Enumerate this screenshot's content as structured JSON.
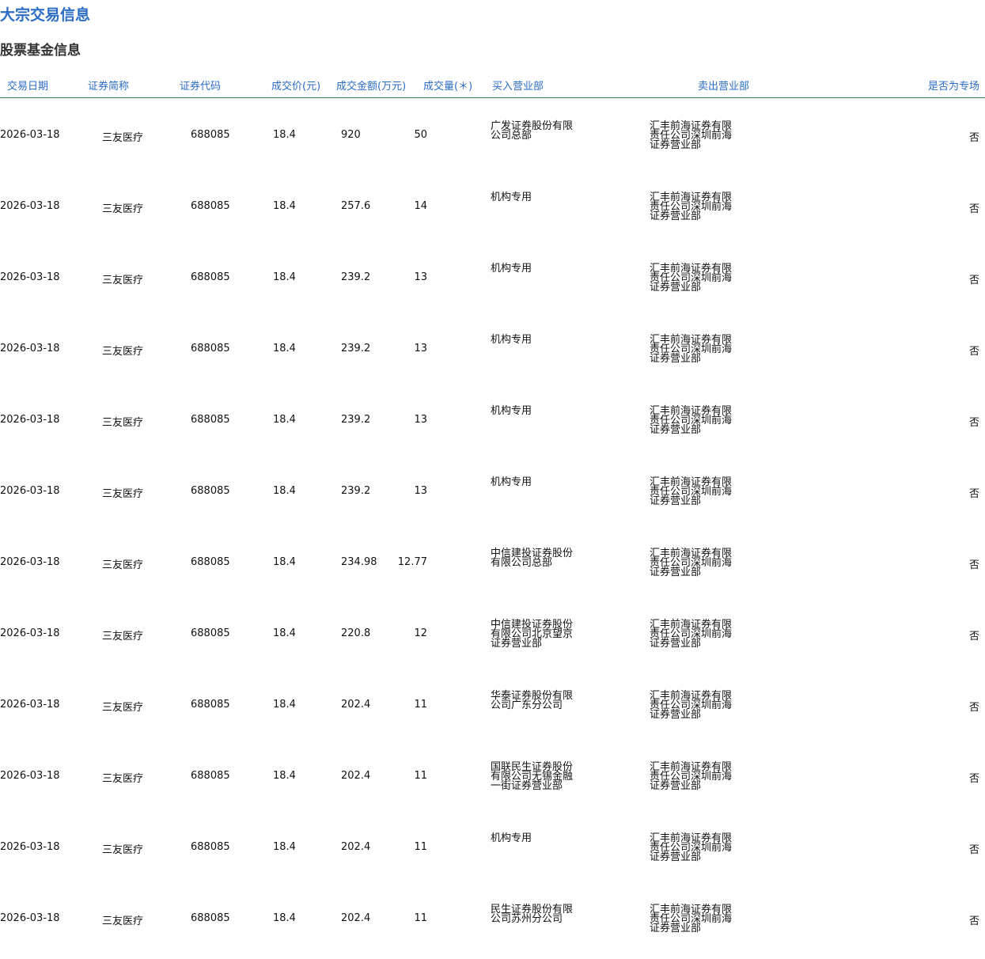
{
  "page": {
    "title": "大宗交易信息",
    "section_title": "股票基金信息"
  },
  "table": {
    "headers": {
      "date": "交易日期",
      "name": "证券简称",
      "code": "证券代码",
      "price": "成交价(元)",
      "amount": "成交金额(万元)",
      "volume": "成交量(＊)",
      "buyer": "买入营业部",
      "seller": "卖出营业部",
      "special": "是否为专场"
    },
    "rows": [
      {
        "date": "2026-03-18",
        "name": "三友医疗",
        "code": "688085",
        "price": "18.4",
        "amount": "920",
        "volume": "50",
        "buyer": "广发证券股份有限公司总部",
        "seller": "汇丰前海证券有限责任公司深圳前海证券营业部",
        "special": "否"
      },
      {
        "date": "2026-03-18",
        "name": "三友医疗",
        "code": "688085",
        "price": "18.4",
        "amount": "257.6",
        "volume": "14",
        "buyer": "机构专用",
        "seller": "汇丰前海证券有限责任公司深圳前海证券营业部",
        "special": "否"
      },
      {
        "date": "2026-03-18",
        "name": "三友医疗",
        "code": "688085",
        "price": "18.4",
        "amount": "239.2",
        "volume": "13",
        "buyer": "机构专用",
        "seller": "汇丰前海证券有限责任公司深圳前海证券营业部",
        "special": "否"
      },
      {
        "date": "2026-03-18",
        "name": "三友医疗",
        "code": "688085",
        "price": "18.4",
        "amount": "239.2",
        "volume": "13",
        "buyer": "机构专用",
        "seller": "汇丰前海证券有限责任公司深圳前海证券营业部",
        "special": "否"
      },
      {
        "date": "2026-03-18",
        "name": "三友医疗",
        "code": "688085",
        "price": "18.4",
        "amount": "239.2",
        "volume": "13",
        "buyer": "机构专用",
        "seller": "汇丰前海证券有限责任公司深圳前海证券营业部",
        "special": "否"
      },
      {
        "date": "2026-03-18",
        "name": "三友医疗",
        "code": "688085",
        "price": "18.4",
        "amount": "239.2",
        "volume": "13",
        "buyer": "机构专用",
        "seller": "汇丰前海证券有限责任公司深圳前海证券营业部",
        "special": "否"
      },
      {
        "date": "2026-03-18",
        "name": "三友医疗",
        "code": "688085",
        "price": "18.4",
        "amount": "234.98",
        "volume": "12.77",
        "buyer": "中信建投证券股份有限公司总部",
        "seller": "汇丰前海证券有限责任公司深圳前海证券营业部",
        "special": "否"
      },
      {
        "date": "2026-03-18",
        "name": "三友医疗",
        "code": "688085",
        "price": "18.4",
        "amount": "220.8",
        "volume": "12",
        "buyer": "中信建投证券股份有限公司北京望京证券营业部",
        "seller": "汇丰前海证券有限责任公司深圳前海证券营业部",
        "special": "否"
      },
      {
        "date": "2026-03-18",
        "name": "三友医疗",
        "code": "688085",
        "price": "18.4",
        "amount": "202.4",
        "volume": "11",
        "buyer": "华泰证券股份有限公司广东分公司",
        "seller": "汇丰前海证券有限责任公司深圳前海证券营业部",
        "special": "否"
      },
      {
        "date": "2026-03-18",
        "name": "三友医疗",
        "code": "688085",
        "price": "18.4",
        "amount": "202.4",
        "volume": "11",
        "buyer": "国联民生证券股份有限公司无锡金融一街证券营业部",
        "seller": "汇丰前海证券有限责任公司深圳前海证券营业部",
        "special": "否"
      },
      {
        "date": "2026-03-18",
        "name": "三友医疗",
        "code": "688085",
        "price": "18.4",
        "amount": "202.4",
        "volume": "11",
        "buyer": "机构专用",
        "seller": "汇丰前海证券有限责任公司深圳前海证券营业部",
        "special": "否"
      },
      {
        "date": "2026-03-18",
        "name": "三友医疗",
        "code": "688085",
        "price": "18.4",
        "amount": "202.4",
        "volume": "11",
        "buyer": "民生证券股份有限公司苏州分公司",
        "seller": "汇丰前海证券有限责任公司深圳前海证券营业部",
        "special": "否"
      }
    ]
  },
  "colors": {
    "link_blue": "#2b6cc4",
    "header_rule": "#2f7d4a"
  }
}
